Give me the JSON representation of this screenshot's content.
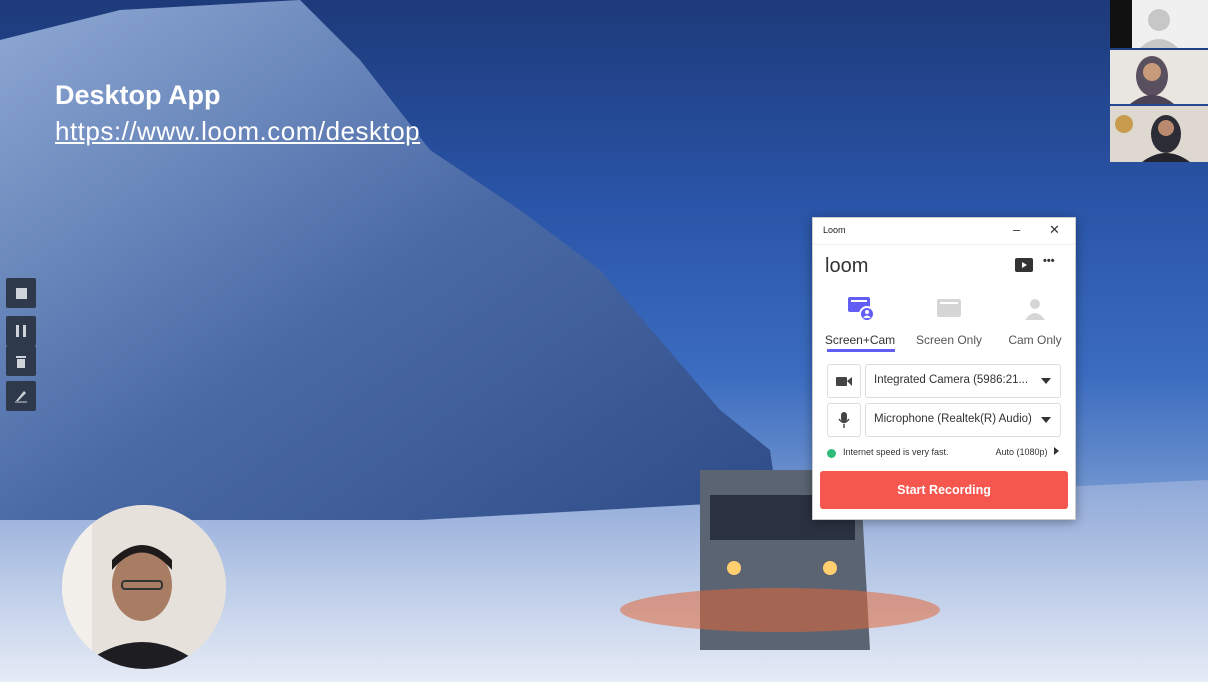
{
  "slide": {
    "title": "Desktop App",
    "link": "https://www.loom.com/desktop"
  },
  "recorder_toolbar": {
    "icons": [
      "stop-icon",
      "pause-icon",
      "trash-icon",
      "draw-icon"
    ]
  },
  "loom_window": {
    "window_title": "Loom",
    "minimize_glyph": "–",
    "close_glyph": "✕",
    "logo": "loom",
    "more_glyph": "•••",
    "modes": [
      {
        "label": "Screen+Cam",
        "icon": "screen-cam-icon",
        "active": true
      },
      {
        "label": "Screen Only",
        "icon": "screen-icon",
        "active": false
      },
      {
        "label": "Cam Only",
        "icon": "person-icon",
        "active": false
      }
    ],
    "camera_value": "Integrated Camera (5986:21...",
    "microphone_value": "Microphone (Realtek(R) Audio)",
    "internet_status": "Internet speed is very fast.",
    "quality": "Auto (1080p)",
    "start_button": "Start Recording",
    "accent_color": "#625df5",
    "button_color": "#f5574e",
    "status_color": "#2dbd79"
  }
}
